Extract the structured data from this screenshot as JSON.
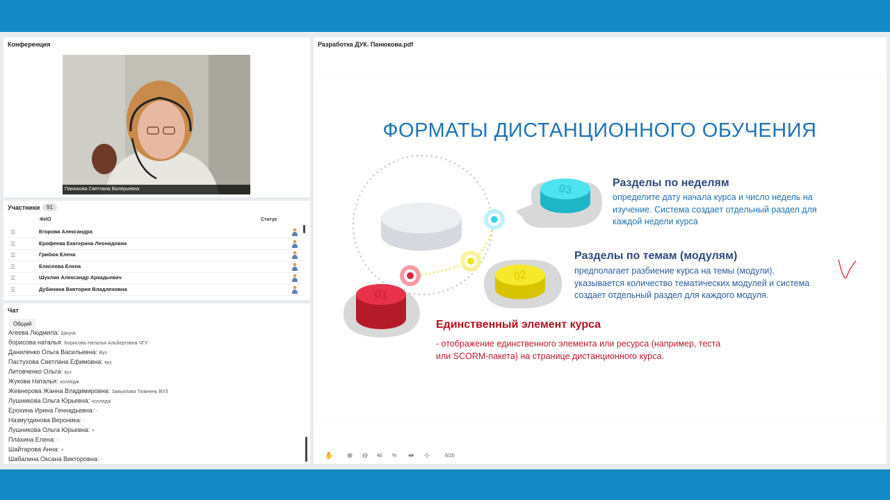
{
  "conference": {
    "title": "Конференция",
    "video_caption": "Панюкова Светлана   Валерьевна"
  },
  "participants": {
    "title": "Участники",
    "count": "91",
    "col_name": "ФИО",
    "col_status": "Статус",
    "rows": [
      "Егорова Александра",
      "Ерофеева Екатерина Леонидовна",
      "Грибюк Елена",
      "Елисеева Елена",
      "Шуклин Александр Аркадьевич",
      "Дубинина Виктория  Владленовна"
    ]
  },
  "chat": {
    "title": "Чат",
    "tab": "Общий",
    "messages": [
      {
        "name": "Агеева Людмила:",
        "text": "Школа"
      },
      {
        "name": "борисова наталья:",
        "text": "Борисова Наталья Альбертовна ЧГУ"
      },
      {
        "name": "Даниленко Ольга  Васильевна:",
        "text": "Вуз"
      },
      {
        "name": "Пастухова  Светлана   Ефимовна:",
        "text": "вуз"
      },
      {
        "name": "Литовченко  Ольга:",
        "text": "вуз"
      },
      {
        "name": "Жукова Наталья:",
        "text": "колледж"
      },
      {
        "name": "Жевнерова Жанна   Владимировна:",
        "text": "Завьялова Тюмнень ВУЗ"
      },
      {
        "name": "Лушникова  Ольга   Юрьевна:",
        "text": "колледж"
      },
      {
        "name": "Ерохина Ирина   Геннадьевна:",
        "text": "-"
      },
      {
        "name": "Назмутдинова Вероника:",
        "text": "-"
      },
      {
        "name": "Лушникова  Ольга   Юрьевна:",
        "text": "+"
      },
      {
        "name": "Плахина Елена:",
        "text": "-"
      },
      {
        "name": "Шайтарова Анна:",
        "text": "+"
      },
      {
        "name": "Шабалина Оксана   Викторовна:",
        "text": "-"
      }
    ]
  },
  "document": {
    "title": "Разработка ДУК. Панюкова.pdf",
    "slide": {
      "title": "ФОРМАТЫ ДИСТАНЦИОННОГО ОБУЧЕНИЯ",
      "sections": [
        {
          "number": "03",
          "heading": "Разделы по неделям",
          "body": [
            "определите дату начала курса и число недель на",
            "изучение. Система создает отдельный раздел для",
            "каждой недели курса"
          ]
        },
        {
          "number": "02",
          "heading": "Разделы по темам (модулям)",
          "body": [
            "предполагает разбиение курса на темы (модули).",
            "указывается количество тематических модулей и система",
            "создает отдельный раздел для каждого модуля."
          ]
        },
        {
          "number": "01",
          "heading": "Единственный элемент курса",
          "body": [
            "- отображение единственного элемента или ресурса (например, теста",
            "или SCORM-пакета) на странице дистанционного курса."
          ]
        }
      ]
    },
    "toolbar": {
      "zoom_value": "46",
      "zoom_unit": "%",
      "page": "6/20"
    }
  },
  "colors": {
    "frame_blue": "#1589c6",
    "title_blue": "#1f73b7",
    "heading_navy": "#2e4a7d",
    "heading_red": "#b3121f",
    "cyan": "#3fd6e6",
    "yellow": "#f2e21a",
    "red": "#e0243a"
  }
}
